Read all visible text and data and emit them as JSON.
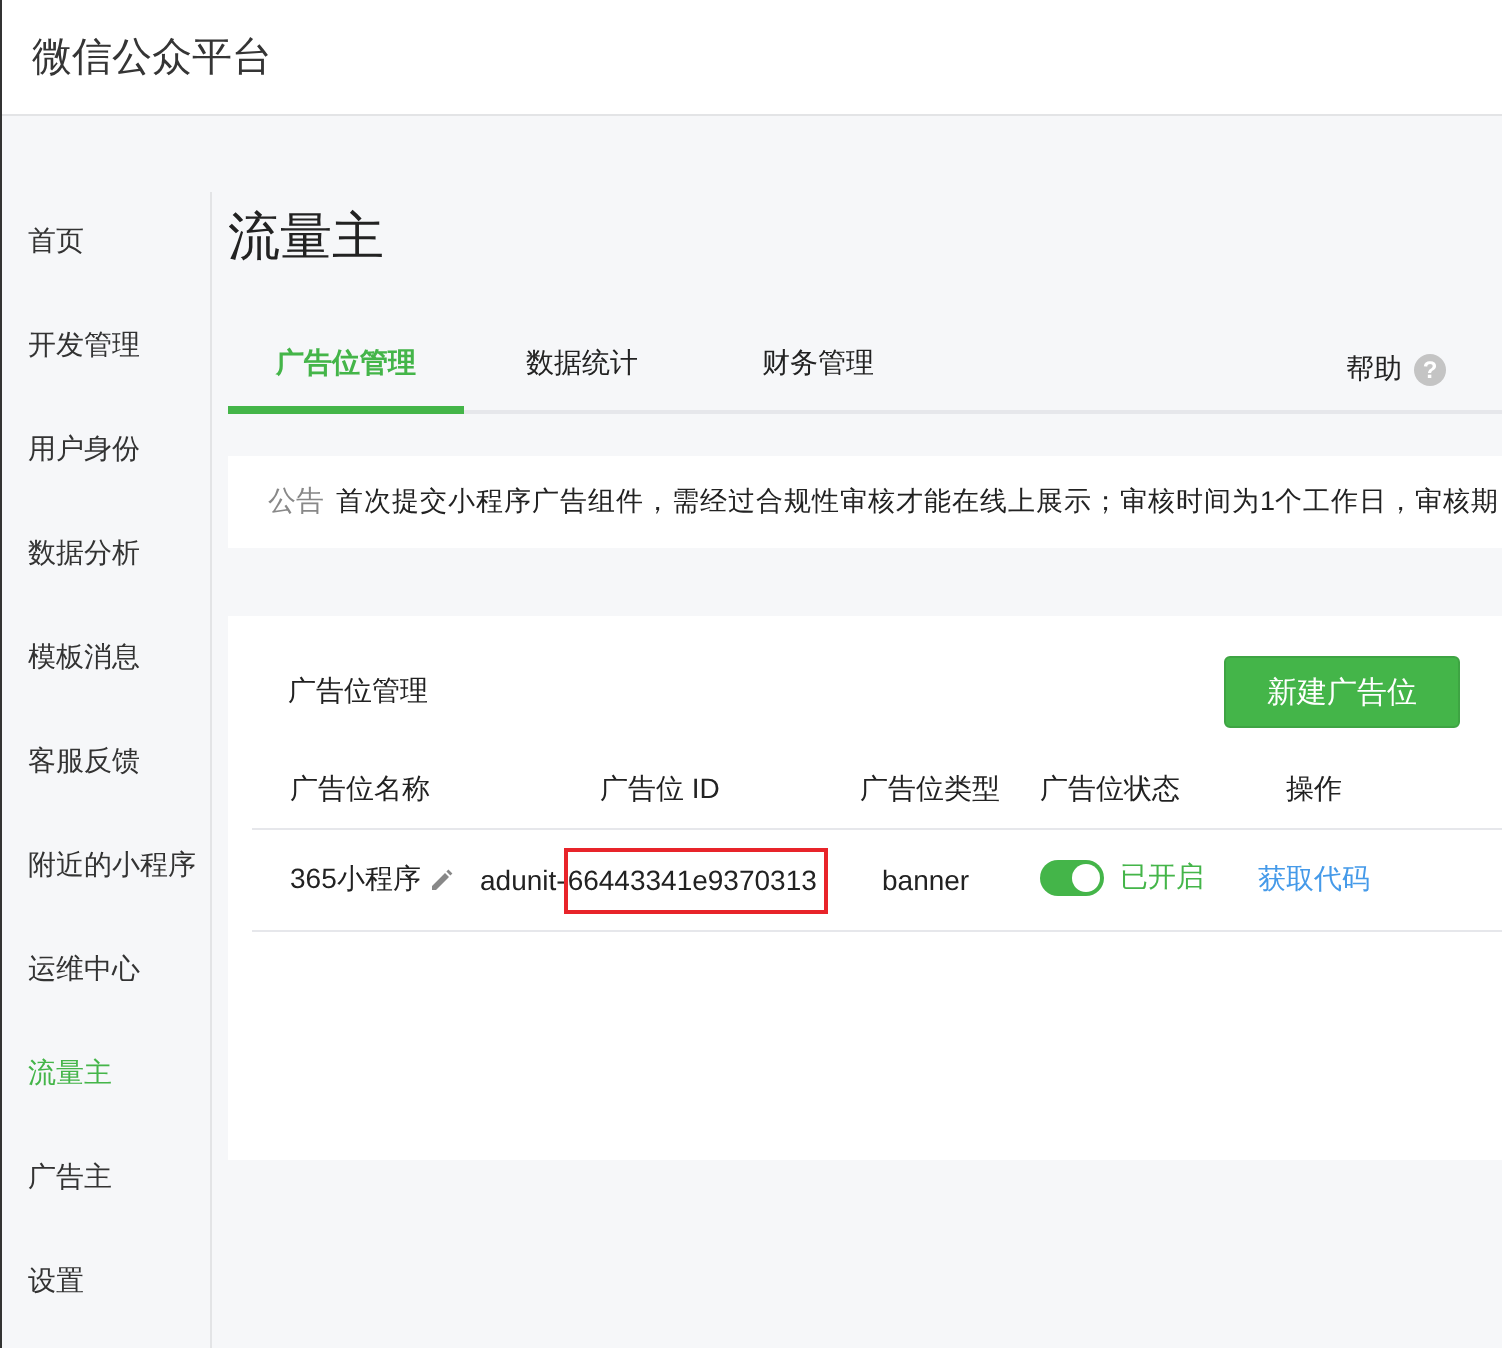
{
  "header": {
    "title": "微信公众平台"
  },
  "sidebar": {
    "items": [
      {
        "label": "首页",
        "selected": false
      },
      {
        "label": "开发管理",
        "selected": false
      },
      {
        "label": "用户身份",
        "selected": false
      },
      {
        "label": "数据分析",
        "selected": false
      },
      {
        "label": "模板消息",
        "selected": false
      },
      {
        "label": "客服反馈",
        "selected": false
      },
      {
        "label": "附近的小程序",
        "selected": false
      },
      {
        "label": "运维中心",
        "selected": false
      },
      {
        "label": "流量主",
        "selected": true
      },
      {
        "label": "广告主",
        "selected": false
      },
      {
        "label": "设置",
        "selected": false
      }
    ]
  },
  "page_title": "流量主",
  "tabs": [
    {
      "label": "广告位管理",
      "selected": true
    },
    {
      "label": "数据统计",
      "selected": false
    },
    {
      "label": "财务管理",
      "selected": false
    }
  ],
  "help": {
    "label": "帮助",
    "icon": "?"
  },
  "notice": {
    "label": "公告",
    "text": "首次提交小程序广告组件，需经过合规性审核才能在线上展示；审核时间为1个工作日，审核期"
  },
  "card": {
    "title": "广告位管理",
    "button": "新建广告位",
    "table": {
      "columns": [
        "广告位名称",
        "广告位 ID",
        "广告位类型",
        "广告位状态",
        "操作"
      ],
      "rows": [
        {
          "name": "365小程序",
          "id_prefix": "adunit-",
          "id_rest": "66443341e9370313",
          "boxed": true,
          "type": "banner",
          "on": true,
          "status": "已开启",
          "action": "获取代码"
        }
      ]
    }
  }
}
